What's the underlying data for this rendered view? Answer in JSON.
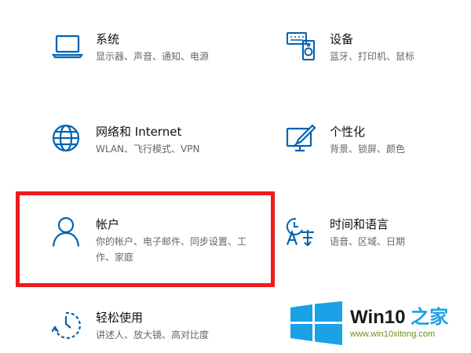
{
  "settings_tiles": [
    {
      "title": "系统",
      "description": "显示器、声音、通知、电源",
      "icon": "laptop-icon"
    },
    {
      "title": "设备",
      "description": "蓝牙、打印机、鼠标",
      "icon": "keyboard-speaker-icon"
    },
    {
      "title": "网络和 Internet",
      "description": "WLAN、飞行模式、VPN",
      "icon": "globe-icon"
    },
    {
      "title": "个性化",
      "description": "背景、锁屏、颜色",
      "icon": "monitor-brush-icon"
    },
    {
      "title": "帐户",
      "description": "你的帐户、电子邮件、同步设置、工作、家庭",
      "icon": "person-icon"
    },
    {
      "title": "时间和语言",
      "description": "语音、区域、日期",
      "icon": "language-clock-icon"
    },
    {
      "title": "轻松使用",
      "description": "讲述人、放大镜、高对比度",
      "icon": "ease-of-access-icon"
    }
  ],
  "watermark": {
    "brand_prefix": "Win10",
    "brand_suffix": "之家",
    "url": "www.win10xitong.com"
  },
  "colors": {
    "icon_blue": "#0063b1",
    "highlight_red": "#ee1c1c",
    "logo_blue": "#1aa1e6",
    "url_green": "#6a8f1a"
  }
}
